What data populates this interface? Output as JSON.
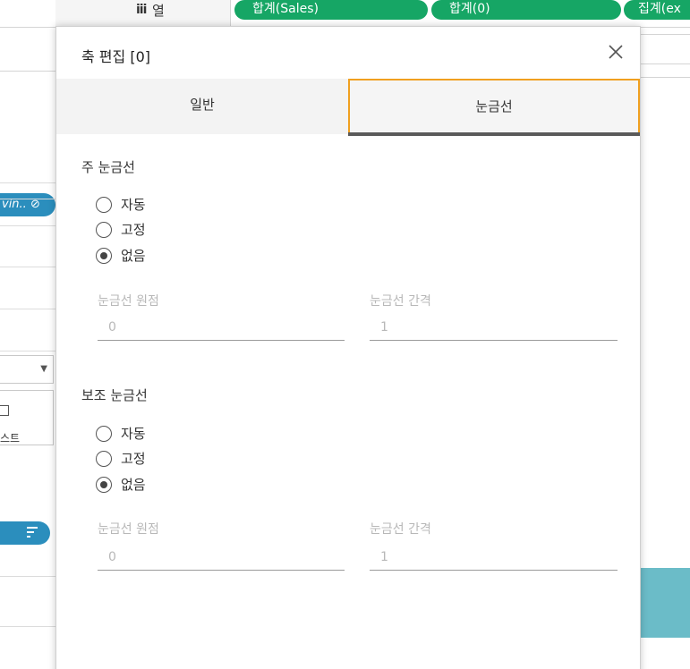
{
  "shelf": {
    "icon": "iii",
    "label": "열",
    "pills": [
      "합계(Sales)",
      "합계(0)",
      "집계(ex"
    ]
  },
  "left_panel": {
    "pill_text": "vin.. ⊘",
    "box_text": "스트"
  },
  "dialog": {
    "title": "축 편집 [0]",
    "tabs": [
      "일반",
      "눈금선"
    ],
    "active_tab": "눈금선",
    "major": {
      "title": "주 눈금선",
      "options": [
        "자동",
        "고정",
        "없음"
      ],
      "selected": "없음",
      "origin_label": "눈금선 원점",
      "origin_value": "0",
      "interval_label": "눈금선 간격",
      "interval_value": "1"
    },
    "minor": {
      "title": "보조 눈금선",
      "options": [
        "자동",
        "고정",
        "없음"
      ],
      "selected": "없음",
      "origin_label": "눈금선 원점",
      "origin_value": "0",
      "interval_label": "눈금선 간격",
      "interval_value": "1"
    }
  },
  "colors": {
    "pill_green": "#16a665",
    "pill_blue": "#2b8ebd",
    "tab_focus": "#f0a020",
    "teal": "#6bbcc8"
  }
}
